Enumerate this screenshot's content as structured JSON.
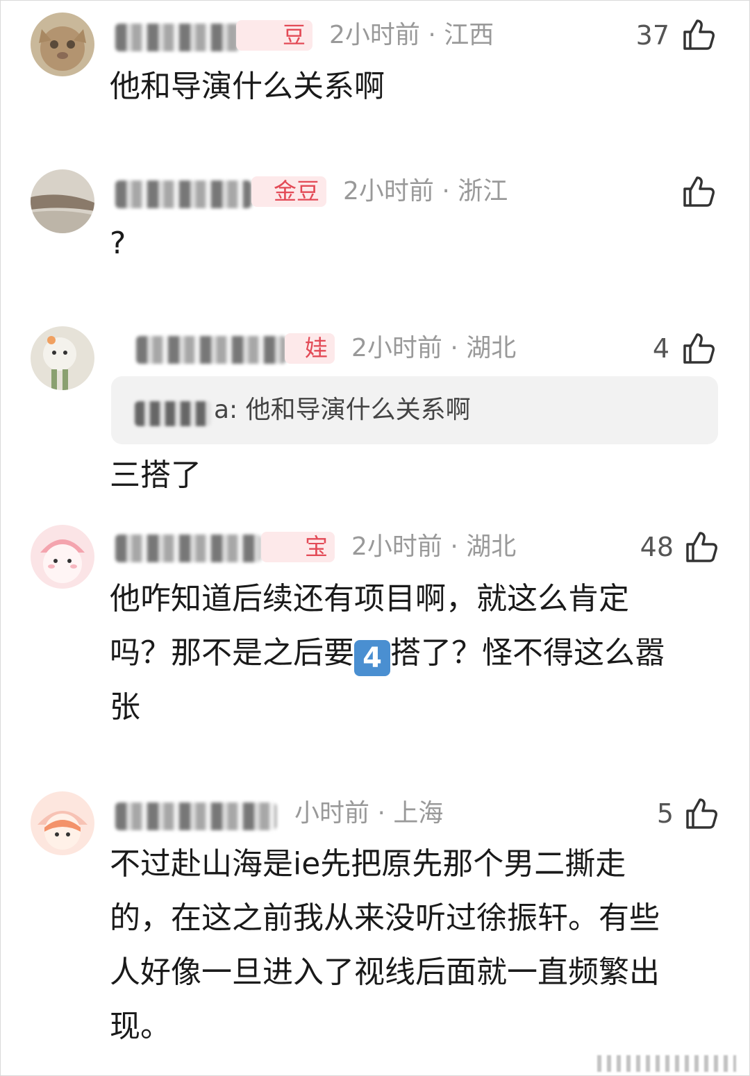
{
  "colors": {
    "badge_bg": "#fde9ea",
    "badge_text": "#e34a56",
    "meta_text": "#999999",
    "body_text": "#1a1a1a",
    "quote_bg": "#f2f2f2"
  },
  "comments": [
    {
      "badge": "豆",
      "time": "2小时前",
      "location": "江西",
      "likes": "37",
      "text": "他和导演什么关系啊",
      "avatar_icon": "cat-photo-avatar"
    },
    {
      "badge": "金豆",
      "time": "2小时前",
      "location": "浙江",
      "likes": "",
      "text": "?",
      "avatar_icon": "landscape-photo-avatar"
    },
    {
      "badge": "娃",
      "time": "2小时前",
      "location": "湖北",
      "likes": "4",
      "quote": "a: 他和导演什么关系啊",
      "text": "三搭了",
      "avatar_icon": "plush-toy-avatar"
    },
    {
      "badge": "宝",
      "time": "2小时前",
      "location": "湖北",
      "likes": "48",
      "text_line1": "他咋知道后续还有项目啊，就这么肯定",
      "text_line2_a": "吗？那不是之后要",
      "emoji": "4",
      "text_line2_b": "搭了？怪不得这么嚣",
      "text_line3": "张",
      "avatar_icon": "pink-cartoon-avatar"
    },
    {
      "time": "小时前",
      "location": "上海",
      "likes": "5",
      "text_lines": [
        "不过赴山海是ie先把原先那个男二撕走",
        "的，在这之前我从来没听过徐振轩。有些",
        "人好像一旦进入了视线后面就一直频繁出",
        "现。"
      ],
      "avatar_icon": "cartoon-girl-avatar"
    }
  ]
}
